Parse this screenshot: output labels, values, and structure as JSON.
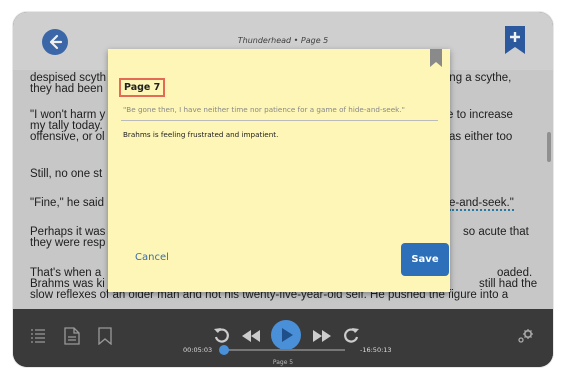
{
  "header": {
    "title": "Thunderhead • Page 5"
  },
  "content": {
    "paragraphs": [
      {
        "left": "despised scyth",
        "left2": "they had been",
        "right": "king a scythe,"
      },
      {
        "left": "\"I won't harm y",
        "left2": "my tally today.",
        "left3": "offensive, or ol",
        "right": "e to increase",
        "right2": "as either too"
      },
      {
        "left": "Still, no one st"
      },
      {
        "left": "\"Fine,\" he said",
        "right": "e-and-seek.\""
      },
      {
        "left": "Perhaps it was",
        "left2": "they were resp",
        "right": "so acute that"
      },
      {
        "left": "That's when a",
        "left2": "Brahms was ki",
        "right": "oaded.",
        "right2": "still had the"
      },
      {
        "full": "slow reflexes of an older man and not his twenty-five-year-old self. He pushed the figure into a"
      }
    ]
  },
  "dialog": {
    "page_label": "Page 7",
    "quote": "\"Be gone then, I have neither time nor patience for a game of hide-and-seek.\"",
    "note": "Brahms is feeling frustrated and impatient.",
    "cancel_label": "Cancel",
    "save_label": "Save"
  },
  "player": {
    "elapsed": "00:05:03",
    "remaining": "-16:50:13",
    "progress": 0.02,
    "page": "Page 5"
  },
  "colors": {
    "accent": "#2d6fb8",
    "dialog_bg": "#fdf6b6",
    "highlight_border": "#e36a55"
  }
}
